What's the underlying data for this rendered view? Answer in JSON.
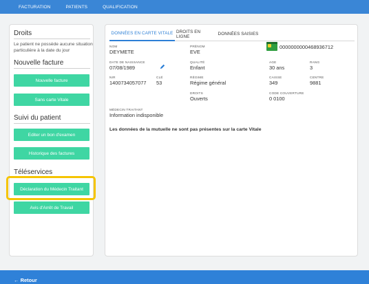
{
  "nav": {
    "items": [
      "FACTURATION",
      "PATIENTS",
      "QUALIFICATION"
    ]
  },
  "sidebar": {
    "rights_title": "Droits",
    "rights_text": "Le patient ne possède aucune situation particulière à la date du jour",
    "new_invoice_title": "Nouvelle facture",
    "new_invoice_button": "Nouvelle facture",
    "no_vitale_button": "Sans carte Vitale",
    "followup_title": "Suivi du patient",
    "exam_button": "Editer un bon d'examen",
    "history_button": "Historique des factures",
    "teleservices_title": "Téléservices",
    "doctor_declaration_button": "Déclaration du Médecin Traitant",
    "work_stop_button": "Avis d'Arrêt de Travail"
  },
  "tabs": [
    "DONNÉES EN CARTE VITALE",
    "DROITS EN LIGNE",
    "DONNÉES SAISIES"
  ],
  "card_number": "0000000000468936712",
  "patient": {
    "nom_label": "NOM",
    "nom": "DEYMETE",
    "prenom_label": "PRÉNOM",
    "prenom": "EVE",
    "dob_label": "DATE DE NAISSANCE",
    "dob": "07/08/1989",
    "qualite_label": "QUALITÉ",
    "qualite": "Enfant",
    "age_label": "AGE",
    "age": "30 ans",
    "rang_label": "RANG",
    "rang": "3",
    "nir_label": "NIR",
    "nir": "1400734057077",
    "cle_label": "CLÉ",
    "cle": "53",
    "regime_label": "RÉGIME",
    "regime": "Régime général",
    "caisse_label": "CAISSE",
    "caisse": "349",
    "centre_label": "CENTRE",
    "centre": "9881",
    "droits_label": "DROITS",
    "droits": "Ouverts",
    "code_label": "CODE COUVERTURE",
    "code": "0 0100",
    "medecin_label": "MÉDECIN TRAITANT",
    "medecin": "Information indisponible",
    "mutuelle_notice": "Les données de la mutuelle ne sont pas présentes sur la carte Vitale"
  },
  "footer": {
    "back_label": "← Retour"
  },
  "colors": {
    "nav": "#3a86d6",
    "button": "#3fd6a3",
    "highlight": "#f5c400",
    "active_tab": "#2c7fd6"
  }
}
